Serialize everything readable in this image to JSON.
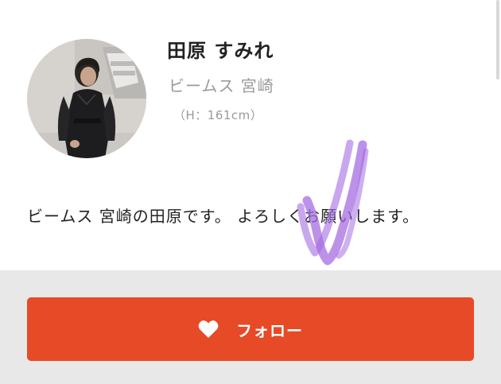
{
  "profile": {
    "name": "田原 すみれ",
    "shop": "ビームス 宮崎",
    "height": "（H：161cm）",
    "bio": "ビームス 宮崎の田原です。 よろしくお願いします。"
  },
  "actions": {
    "follow_label": "フォロー",
    "follow_icon": "heart-icon"
  },
  "colors": {
    "accent": "#e64a26",
    "footer_bg": "#e8e8e8",
    "muted_text": "#9a9a9a",
    "annotation": "#a56de2"
  }
}
